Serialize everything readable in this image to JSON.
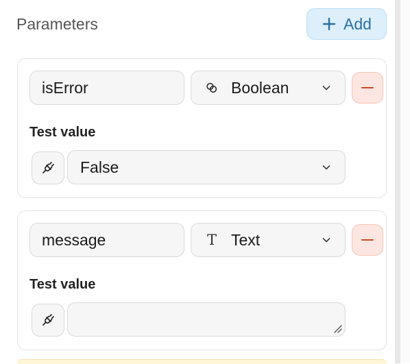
{
  "header": {
    "title": "Parameters",
    "add_label": "Add"
  },
  "params": [
    {
      "name": "isError",
      "type": "Boolean",
      "type_icon": "boolean-icon",
      "test_value_label": "Test value",
      "test_value": "False"
    },
    {
      "name": "message",
      "type": "Text",
      "type_icon": "text-type-icon",
      "type_glyph": "T",
      "test_value_label": "Test value",
      "test_value": ""
    }
  ],
  "colors": {
    "accent": "#2b6fa3",
    "add_bg": "#dceffb",
    "remove": "#d1481f",
    "remove_bg": "#fde6e1"
  }
}
